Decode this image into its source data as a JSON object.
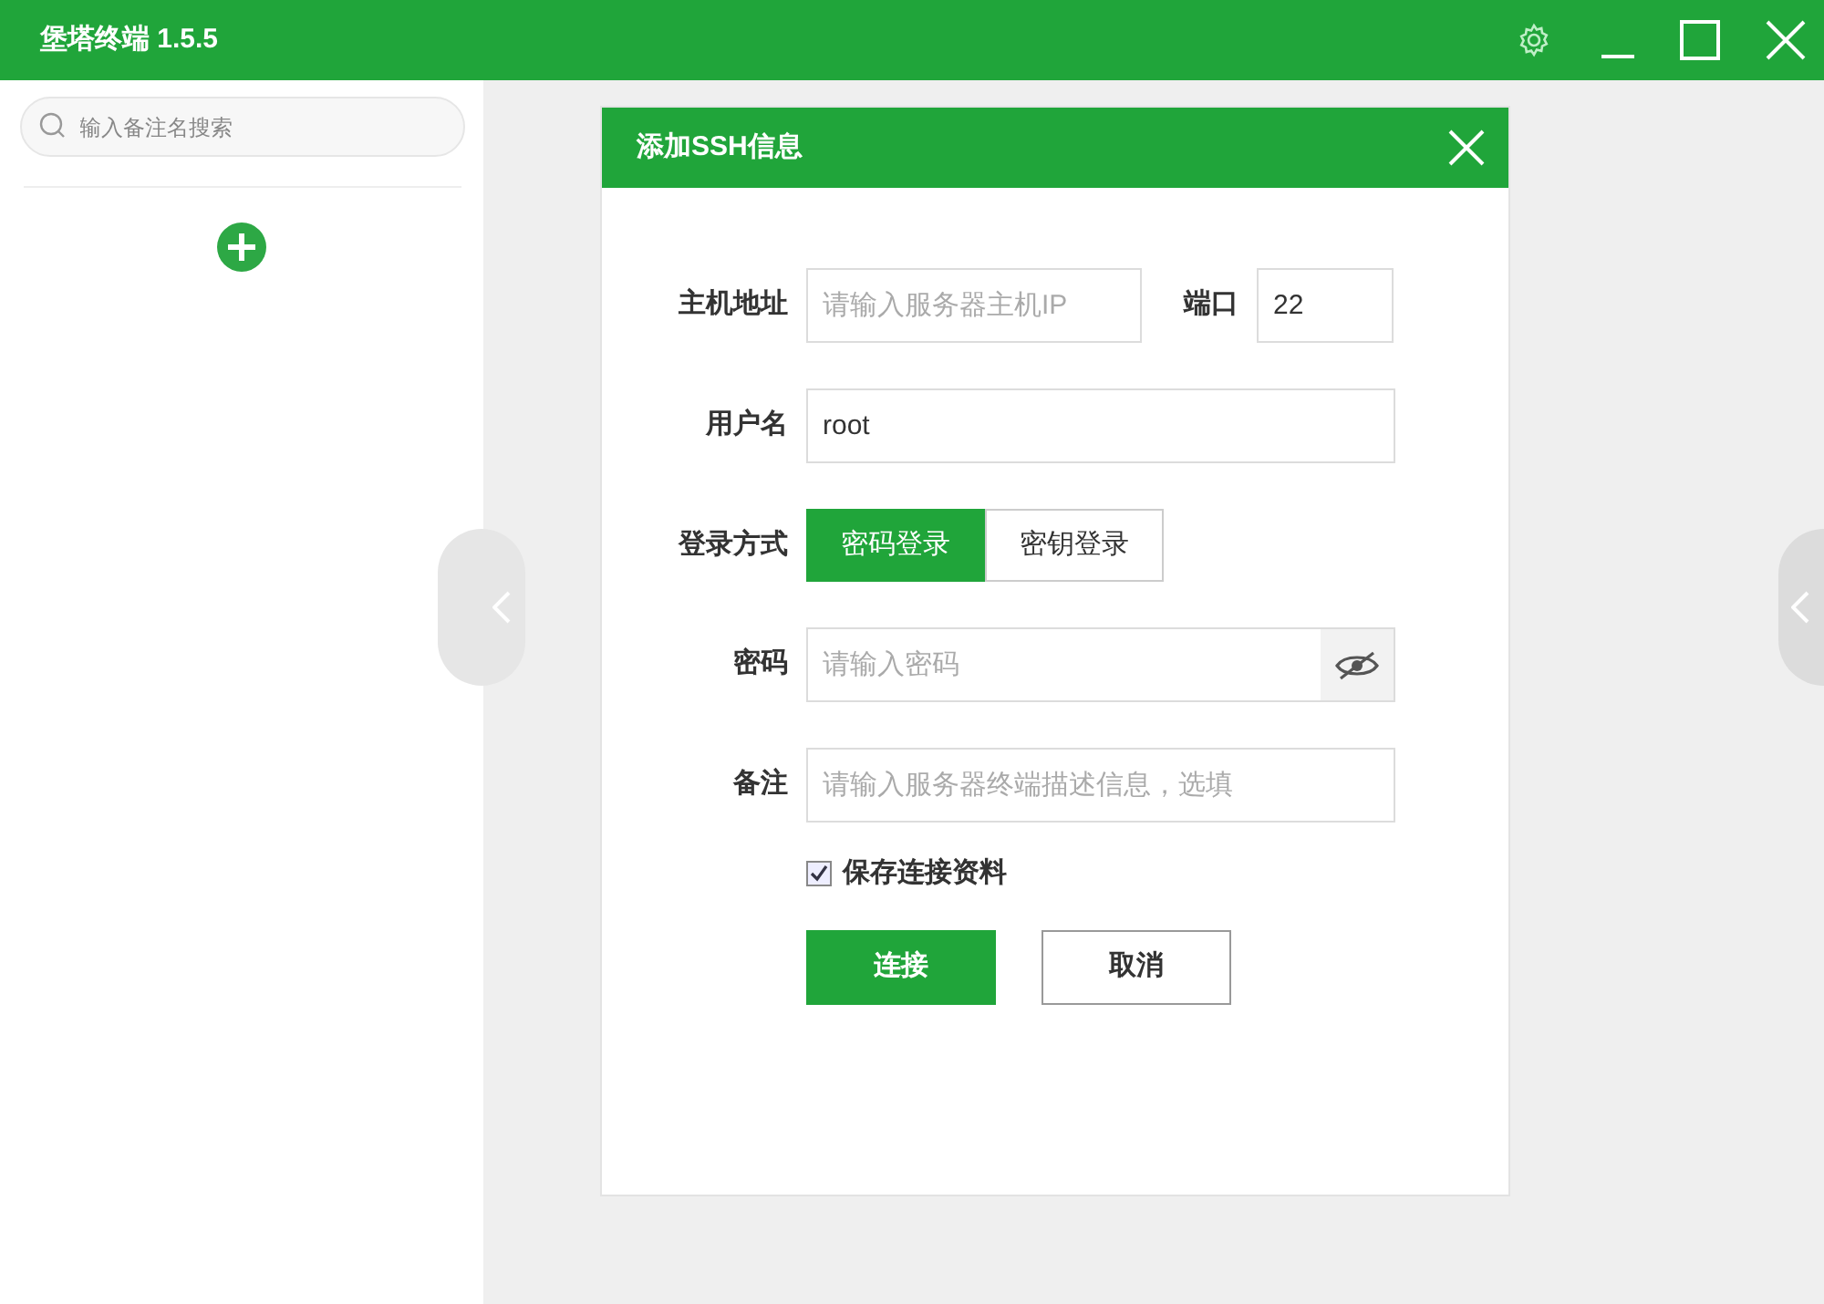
{
  "window": {
    "title": "堡塔终端 1.5.5"
  },
  "sidebar": {
    "search": {
      "placeholder": "输入备注名搜索"
    }
  },
  "dialog": {
    "title": "添加SSH信息",
    "host": {
      "label": "主机地址",
      "placeholder": "请输入服务器主机IP"
    },
    "port": {
      "label": "端口",
      "value": "22"
    },
    "username": {
      "label": "用户名",
      "value": "root"
    },
    "login_method": {
      "label": "登录方式",
      "options": [
        {
          "label": "密码登录",
          "selected": true
        },
        {
          "label": "密钥登录",
          "selected": false
        }
      ]
    },
    "password": {
      "label": "密码",
      "placeholder": "请输入密码"
    },
    "note": {
      "label": "备注",
      "placeholder": "请输入服务器终端描述信息，选填"
    },
    "save": {
      "label": "保存连接资料",
      "checked": true
    },
    "buttons": [
      {
        "label": "连接",
        "kind": "primary"
      },
      {
        "label": "取消",
        "kind": "secondary"
      }
    ]
  }
}
